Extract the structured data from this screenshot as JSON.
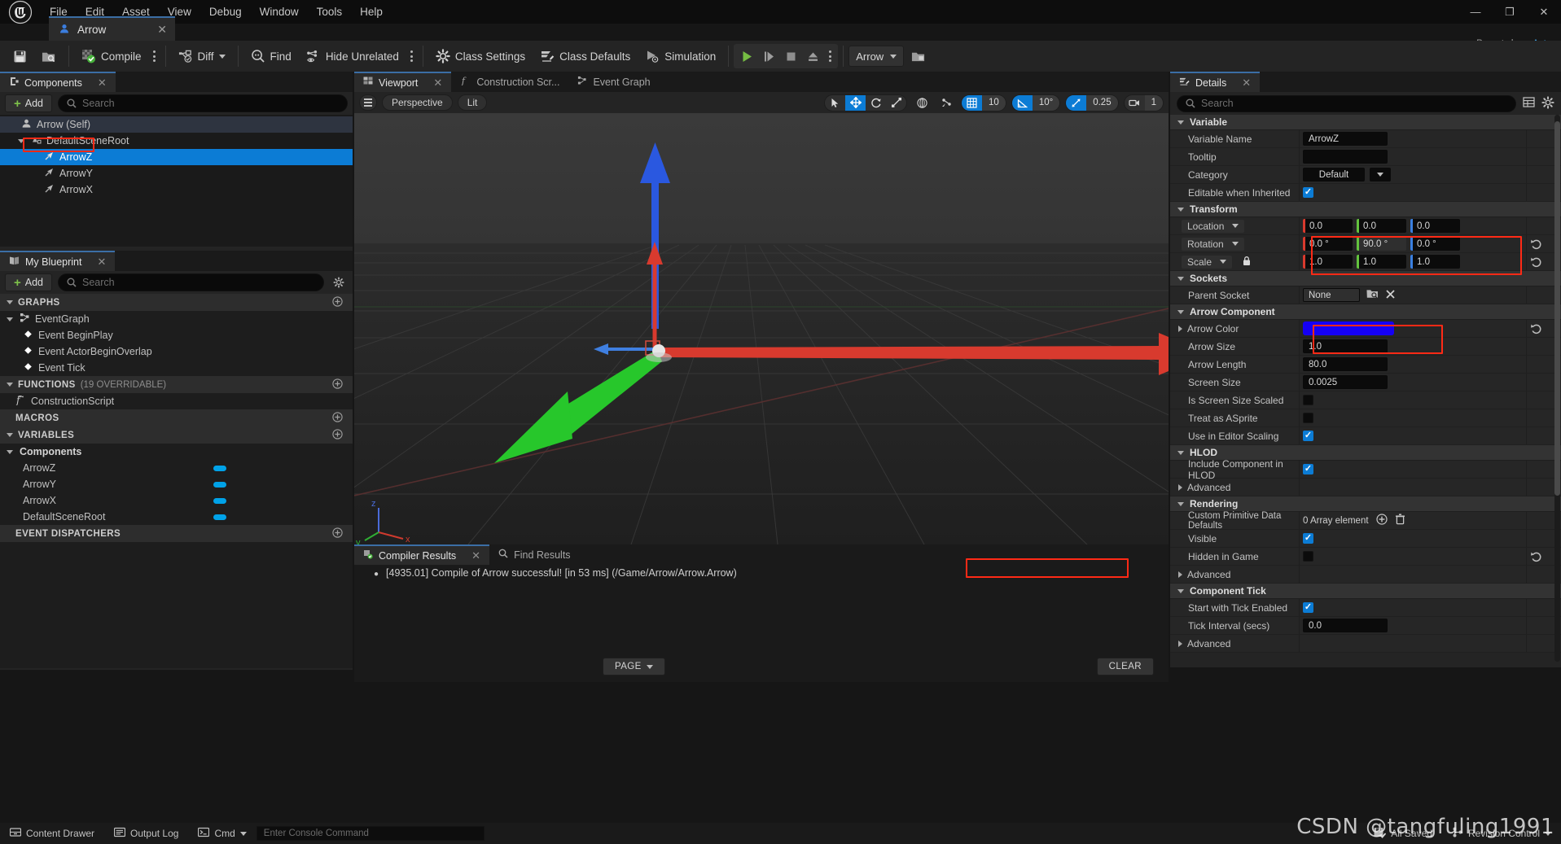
{
  "app": {
    "menu": [
      "File",
      "Edit",
      "Asset",
      "View",
      "Debug",
      "Window",
      "Tools",
      "Help"
    ],
    "document_tab": "Arrow",
    "parent_class_label": "Parent class:",
    "parent_class_value": "Actor",
    "window_buttons": {
      "minimize": "—",
      "maximize": "❐",
      "close": "✕"
    }
  },
  "toolbar": {
    "save_icon": "save-icon",
    "browse_icon": "browse-to-asset-icon",
    "compile": "Compile",
    "diff": "Diff",
    "find": "Find",
    "hide_unrelated": "Hide Unrelated",
    "class_settings": "Class Settings",
    "class_defaults": "Class Defaults",
    "simulation": "Simulation",
    "play": "play-icon",
    "step": "step-icon",
    "stop": "stop-icon",
    "eject": "eject-icon",
    "play_options": "play-options-icon",
    "play_mode": "Arrow",
    "platforms_icon": "platforms-icon"
  },
  "components_panel": {
    "tab_label": "Components",
    "tab_close": "✕",
    "add_label": "Add",
    "search_placeholder": "Search",
    "tree": [
      {
        "label": "Arrow (Self)",
        "depth": 0,
        "icon": "actor-icon",
        "state": "root",
        "expander": "none"
      },
      {
        "label": "DefaultSceneRoot",
        "depth": 1,
        "icon": "scene-root-icon",
        "state": "normal",
        "expander": "down"
      },
      {
        "label": "ArrowZ",
        "depth": 2,
        "icon": "arrow-component-icon",
        "state": "selected",
        "expander": "none"
      },
      {
        "label": "ArrowY",
        "depth": 2,
        "icon": "arrow-component-icon",
        "state": "normal",
        "expander": "none"
      },
      {
        "label": "ArrowX",
        "depth": 2,
        "icon": "arrow-component-icon",
        "state": "normal",
        "expander": "none"
      }
    ]
  },
  "myblueprint_panel": {
    "tab_label": "My Blueprint",
    "tab_close": "✕",
    "add_label": "Add",
    "search_placeholder": "Search",
    "settings_icon": "gear-icon",
    "sections": [
      {
        "title": "GRAPHS",
        "sub": "",
        "expander": "down",
        "plus": true,
        "items": [
          {
            "label": "EventGraph",
            "depth": 0,
            "icon": "graph-icon",
            "expander": "down"
          },
          {
            "label": "Event BeginPlay",
            "depth": 1,
            "icon": "event-node-icon",
            "expander": "none"
          },
          {
            "label": "Event ActorBeginOverlap",
            "depth": 1,
            "icon": "event-node-icon",
            "expander": "none"
          },
          {
            "label": "Event Tick",
            "depth": 1,
            "icon": "event-node-icon",
            "expander": "none"
          }
        ]
      },
      {
        "title": "FUNCTIONS",
        "sub": "(19 OVERRIDABLE)",
        "expander": "down",
        "plus": true,
        "items": [
          {
            "label": "ConstructionScript",
            "depth": 0,
            "icon": "function-icon",
            "expander": "none"
          }
        ]
      },
      {
        "title": "MACROS",
        "sub": "",
        "expander": "none",
        "plus": true,
        "items": []
      },
      {
        "title": "VARIABLES",
        "sub": "",
        "expander": "down",
        "plus": true,
        "items": [
          {
            "label": "Components",
            "depth": 0,
            "icon": "",
            "expander": "down"
          },
          {
            "label": "ArrowZ",
            "depth": 1,
            "icon": "",
            "expander": "none",
            "pill": true
          },
          {
            "label": "ArrowY",
            "depth": 1,
            "icon": "",
            "expander": "none",
            "pill": true
          },
          {
            "label": "ArrowX",
            "depth": 1,
            "icon": "",
            "expander": "none",
            "pill": true
          },
          {
            "label": "DefaultSceneRoot",
            "depth": 1,
            "icon": "",
            "expander": "none",
            "pill": true
          }
        ]
      },
      {
        "title": "EVENT DISPATCHERS",
        "sub": "",
        "expander": "none",
        "plus": true,
        "items": []
      }
    ]
  },
  "viewport_panel": {
    "tabs": [
      {
        "label": "Viewport",
        "icon": "viewport-icon",
        "active": true,
        "close": "✕"
      },
      {
        "label": "Construction Scr...",
        "icon": "function-icon",
        "active": false
      },
      {
        "label": "Event Graph",
        "icon": "graph-icon",
        "active": false
      }
    ],
    "view_menu_icon": "hamburger-icon",
    "camera_mode": "Perspective",
    "view_mode": "Lit",
    "transform_tools": [
      "select-icon",
      "move-icon",
      "rotate-icon",
      "scale-icon"
    ],
    "active_transform_tool": 1,
    "coord_system_icon": "world-coord-icon",
    "surface_snap_icon": "surface-snap-icon",
    "grid_snap": {
      "icon": "grid-snap-icon",
      "value": "10",
      "on": true
    },
    "angle_snap": {
      "icon": "angle-snap-icon",
      "value": "10°",
      "on": true
    },
    "scale_snap": {
      "icon": "scale-snap-icon",
      "value": "0.25",
      "on": true
    },
    "camera_speed": {
      "icon": "camera-icon",
      "value": "1",
      "on": false
    },
    "axis_labels": {
      "x": "x",
      "y": "y",
      "z": "z"
    }
  },
  "compiler_panel": {
    "tabs": [
      {
        "label": "Compiler Results",
        "icon": "compiler-results-icon",
        "active": true,
        "close": "✕"
      },
      {
        "label": "Find Results",
        "icon": "search-icon",
        "active": false
      }
    ],
    "message_bullet": "●",
    "message": "[4935.01] Compile of Arrow successful! [in 53 ms] (/Game/Arrow/Arrow.Arrow)",
    "page_button": "PAGE",
    "clear_button": "CLEAR"
  },
  "details_panel": {
    "tab_label": "Details",
    "tab_close": "✕",
    "search_placeholder": "Search",
    "column_icon": "columns-icon",
    "settings_icon": "gear-icon",
    "categories": [
      {
        "name": "Variable",
        "rows": [
          {
            "label": "Variable Name",
            "type": "text",
            "value": "ArrowZ"
          },
          {
            "label": "Tooltip",
            "type": "text",
            "value": ""
          },
          {
            "label": "Category",
            "type": "combo",
            "value": "Default"
          },
          {
            "label": "Editable when Inherited",
            "type": "checkbox",
            "checked": true
          }
        ]
      },
      {
        "name": "Transform",
        "rows": [
          {
            "label": "Location",
            "type": "vector",
            "dropdown": true,
            "values": [
              "0.0",
              "0.0",
              "0.0"
            ]
          },
          {
            "label": "Rotation",
            "type": "vector",
            "dropdown": true,
            "values": [
              "0.0 °",
              "90.0 °",
              "0.0 °"
            ],
            "revert": true
          },
          {
            "label": "Scale",
            "type": "vector",
            "dropdown": true,
            "lock": true,
            "values": [
              "1.0",
              "1.0",
              "1.0"
            ],
            "revert": true
          }
        ]
      },
      {
        "name": "Sockets",
        "rows": [
          {
            "label": "Parent Socket",
            "type": "socket",
            "value": "None"
          }
        ]
      },
      {
        "name": "Arrow Component",
        "rows": [
          {
            "label": "Arrow Color",
            "type": "color",
            "expander": true,
            "color": "#1500f5",
            "revert": true
          },
          {
            "label": "Arrow Size",
            "type": "text",
            "value": "1.0"
          },
          {
            "label": "Arrow Length",
            "type": "text",
            "value": "80.0"
          },
          {
            "label": "Screen Size",
            "type": "text",
            "value": "0.0025"
          },
          {
            "label": "Is Screen Size Scaled",
            "type": "checkbox",
            "checked": false
          },
          {
            "label": "Treat as ASprite",
            "type": "checkbox",
            "checked": false
          },
          {
            "label": "Use in Editor Scaling",
            "type": "checkbox",
            "checked": true
          }
        ]
      },
      {
        "name": "HLOD",
        "rows": [
          {
            "label": "Include Component in HLOD",
            "type": "checkbox",
            "checked": true
          },
          {
            "label": "Advanced",
            "type": "advanced"
          }
        ]
      },
      {
        "name": "Rendering",
        "rows": [
          {
            "label": "Custom Primitive Data Defaults",
            "type": "array",
            "value": "0 Array element"
          },
          {
            "label": "Visible",
            "type": "checkbox",
            "checked": true
          },
          {
            "label": "Hidden in Game",
            "type": "checkbox",
            "checked": false,
            "revert": true
          },
          {
            "label": "Advanced",
            "type": "advanced"
          }
        ]
      },
      {
        "name": "Component Tick",
        "rows": [
          {
            "label": "Start with Tick Enabled",
            "type": "checkbox",
            "checked": true
          },
          {
            "label": "Tick Interval (secs)",
            "type": "text",
            "value": "0.0"
          },
          {
            "label": "Advanced",
            "type": "advanced"
          }
        ]
      }
    ]
  },
  "statusbar": {
    "content_drawer": "Content Drawer",
    "output_log": "Output Log",
    "cmd_label": "Cmd",
    "console_placeholder": "Enter Console Command",
    "all_saved": "All Saved",
    "revision_control": "Revision Control"
  },
  "watermark": "CSDN @tangfuling1991",
  "colors": {
    "accent_blue": "#0c7cd5",
    "selection_blue": "#0c7cd5",
    "highlight_red": "#ff2a16",
    "arrow_blue": "#1500f5",
    "axis_x": "#d83a2e",
    "axis_y": "#35c23a",
    "axis_z": "#2a58e0",
    "green_play": "#7ec24a"
  }
}
